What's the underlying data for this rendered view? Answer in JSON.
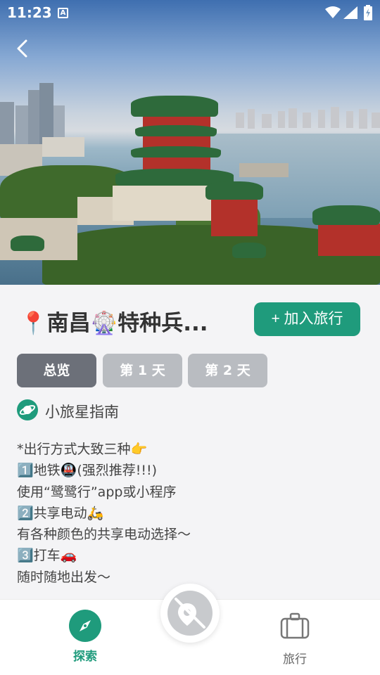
{
  "status_bar": {
    "time": "11:23",
    "notification_letter": "A"
  },
  "trip": {
    "title": "📍南昌🎡特种兵...",
    "add_button_label": "+ 加入旅行"
  },
  "tabs": [
    {
      "label": "总览",
      "active": true
    },
    {
      "label": "第 1 天",
      "active": false
    },
    {
      "label": "第 2 天",
      "active": false
    }
  ],
  "author": {
    "name": "小旅星指南",
    "icon": "planet-icon"
  },
  "content": {
    "lines": [
      "*出行方式大致三种👉",
      "1️⃣地铁🚇(强烈推荐!!!)",
      "使用“鹭鹭行”app或小程序",
      "2️⃣共享电动🛵",
      "有各种颜色的共享电动选择～",
      "3️⃣打车🚗",
      "随时随地出发～"
    ]
  },
  "bottom_nav": {
    "items": [
      {
        "label": "探索",
        "icon": "compass-icon",
        "active": true
      },
      {
        "label": "旅行",
        "icon": "suitcase-icon",
        "active": false
      }
    ],
    "fab_icon": "location-off-icon"
  },
  "colors": {
    "accent": "#1f9b7c",
    "tab_active": "#6c7079",
    "tab_inactive": "#b9bcc1",
    "background": "#f4f4f6"
  }
}
